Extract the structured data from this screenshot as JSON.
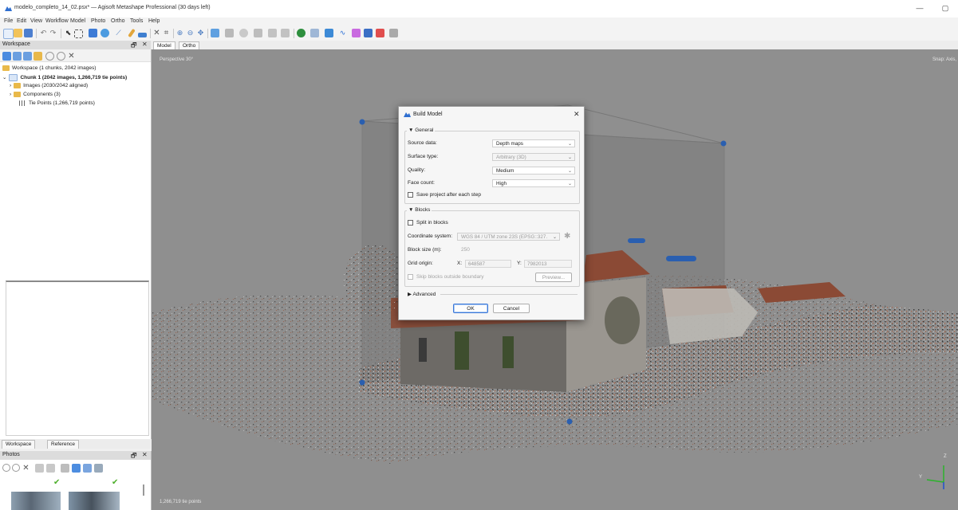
{
  "window": {
    "title": "modelo_completo_14_02.psx* — Agisoft Metashape Professional (30 days left)",
    "minimize_glyph": "—",
    "restore_glyph": "▢"
  },
  "menu": [
    "File",
    "Edit",
    "View",
    "Workflow",
    "Model",
    "Photo",
    "Ortho",
    "Tools",
    "Help"
  ],
  "colors": {
    "accent": "#3c78d8",
    "viewport_bg": "#8f8f8f",
    "folder": "#e9b94a",
    "check_green": "#4caf2a"
  },
  "workspace": {
    "panel_title": "Workspace",
    "float_glyph": "🗗",
    "close_glyph": "✕",
    "tree": {
      "root": "Workspace (1 chunks, 2042 images)",
      "chunk": "Chunk 1 (2042 images, 1,266,719 tie points)",
      "images": "Images (2030/2042 aligned)",
      "components": "Components (3)",
      "tie_points": "Tie Points (1,266,719 points)"
    }
  },
  "bottom_tabs": [
    "Workspace",
    "Reference"
  ],
  "photos": {
    "panel_title": "Photos"
  },
  "viewport": {
    "tabs": [
      "Model",
      "Ortho"
    ],
    "projection_label": "Perspective 30°",
    "snap_label": "Snap: Axis,",
    "status": "1,266,719 tie points",
    "axis_z": "Z",
    "axis_y": "Y"
  },
  "dialog": {
    "title": "Build Model",
    "close_glyph": "✕",
    "general": {
      "header": "General",
      "source_data_label": "Source data:",
      "source_data_value": "Depth maps",
      "surface_type_label": "Surface type:",
      "surface_type_value": "Arbitrary (3D)",
      "quality_label": "Quality:",
      "quality_value": "Medium",
      "face_count_label": "Face count:",
      "face_count_value": "High",
      "save_project_label": "Save project after each step"
    },
    "blocks": {
      "header": "Blocks",
      "split_label": "Split in blocks",
      "coord_label": "Coordinate system:",
      "coord_value": "WGS 84 / UTM zone 23S (EPSG::327.",
      "block_size_label": "Block size (m):",
      "block_size_value": "250",
      "grid_origin_label": "Grid origin:",
      "x_label": "X:",
      "x_value": "648587",
      "y_label": "Y:",
      "y_value": "7982013",
      "skip_label": "Skip blocks outside boundary",
      "preview_label": "Preview..."
    },
    "advanced_label": "Advanced",
    "ok_label": "OK",
    "cancel_label": "Cancel"
  }
}
